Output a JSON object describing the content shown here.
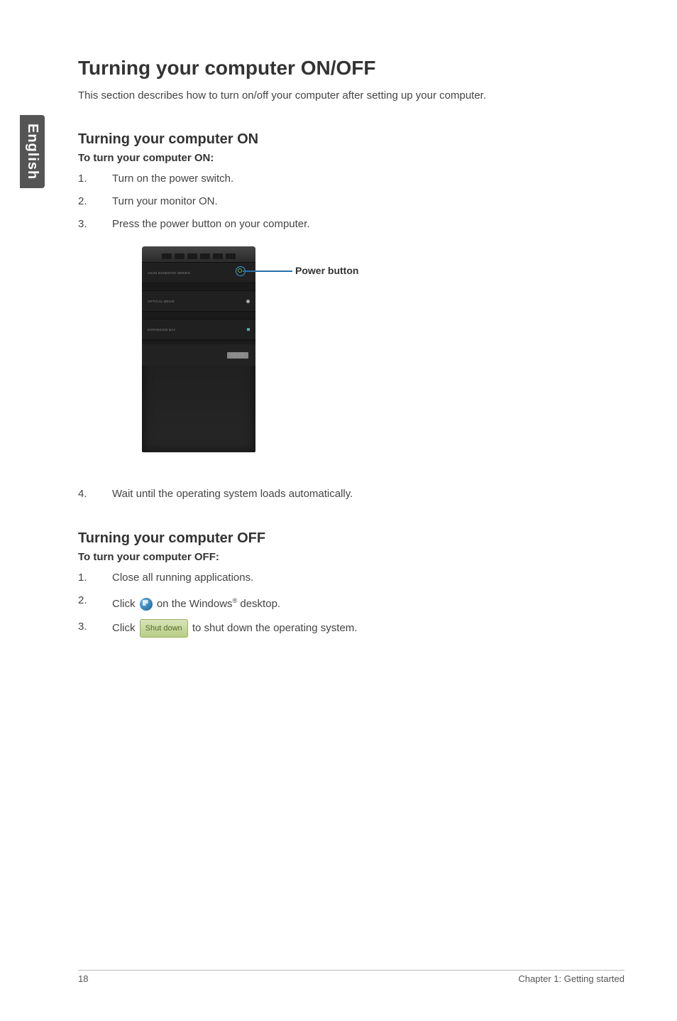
{
  "side_tab": "English",
  "title": "Turning your computer ON/OFF",
  "intro": "This section describes how to turn on/off your computer after setting up your computer.",
  "section_on": {
    "heading": "Turning your computer ON",
    "subhead": "To turn your computer ON:",
    "steps": [
      "Turn on the power switch.",
      "Turn your monitor ON.",
      "Press the power button on your computer."
    ],
    "step4": "Wait until the operating system loads automatically."
  },
  "figure": {
    "power_label": "Power button",
    "tower_labels": {
      "brand_series": "ASUS ESSENTIO SERIES",
      "optical": "OPTICAL DRIVE",
      "expansion": "EXPANSION BAY",
      "logo": "/SUS"
    }
  },
  "section_off": {
    "heading": "Turning your computer OFF",
    "subhead": "To turn your computer OFF:",
    "steps": {
      "s1": "Close all running applications.",
      "s2a": "Click ",
      "s2b": " on the Windows",
      "s2c": " desktop.",
      "s3a": "Click ",
      "s3b_btn": "Shut down",
      "s3c": " to shut down the operating system."
    }
  },
  "footer": {
    "page": "18",
    "chapter": "Chapter 1: Getting started"
  }
}
